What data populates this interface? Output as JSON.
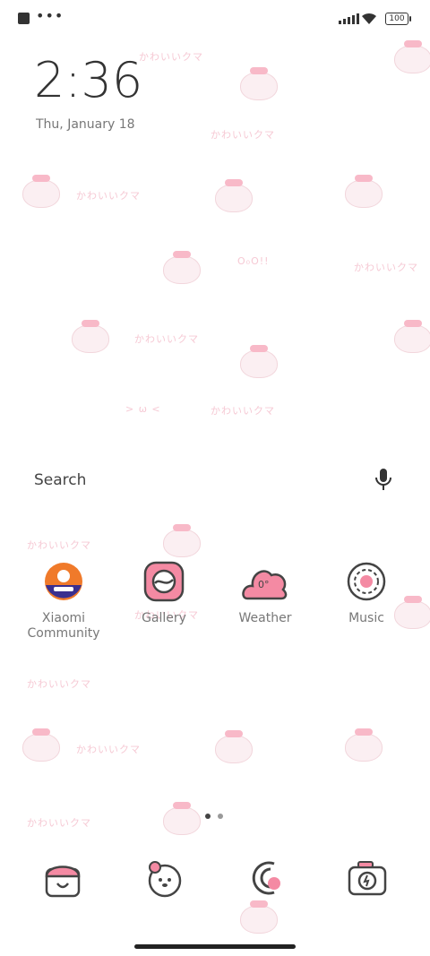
{
  "status_bar": {
    "battery": "100"
  },
  "lockscreen": {
    "time": "2:36",
    "date": "Thu, January 18"
  },
  "search": {
    "placeholder": "Search"
  },
  "wallpaper": {
    "motif_text": "かわいいクマ",
    "faces": [
      "> ω <",
      "O₀O!!"
    ]
  },
  "apps": [
    {
      "label": "Xiaomi\nCommunity",
      "icon": "xiaomi-community-icon"
    },
    {
      "label": "Gallery",
      "icon": "gallery-icon"
    },
    {
      "label": "Weather",
      "icon": "weather-icon",
      "badge": "0°"
    },
    {
      "label": "Music",
      "icon": "music-icon"
    }
  ],
  "dock": [
    {
      "icon": "phone-icon"
    },
    {
      "icon": "bear-messaging-icon"
    },
    {
      "icon": "browser-icon"
    },
    {
      "icon": "camera-icon"
    }
  ],
  "pager": {
    "pages": 2,
    "current": 1
  },
  "colors": {
    "accent_pink": "#f48aa3",
    "text_dark": "#333333"
  }
}
